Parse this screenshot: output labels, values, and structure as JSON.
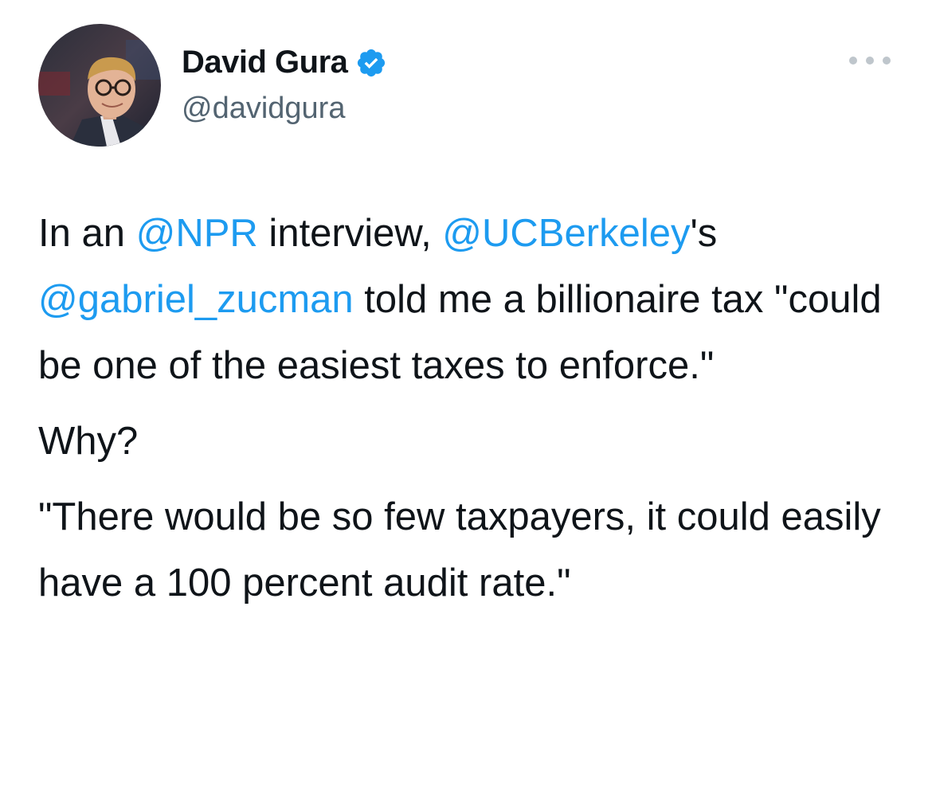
{
  "author": {
    "display_name": "David Gura",
    "handle": "@davidgura",
    "verified": true
  },
  "colors": {
    "text": "#0f1419",
    "secondary_text": "#536471",
    "link": "#1d9bf0",
    "verified_badge": "#1d9bf0",
    "more_dots": "#bfc6cc"
  },
  "icons": {
    "avatar": "profile-photo",
    "verified": "verified-badge-icon",
    "more": "more-options-icon"
  },
  "tweet": {
    "p1": {
      "t1": "In an ",
      "m1": "@NPR",
      "t2": " interview, ",
      "m2": "@UCBerkeley",
      "t3": "'s ",
      "m3": "@gabriel_zucman",
      "t4": " told me a billionaire tax \"could be one of the easiest taxes to enforce.\""
    },
    "p2": "Why?",
    "p3": "\"There would be so few taxpayers, it could easily have a 100 percent audit rate.\""
  }
}
